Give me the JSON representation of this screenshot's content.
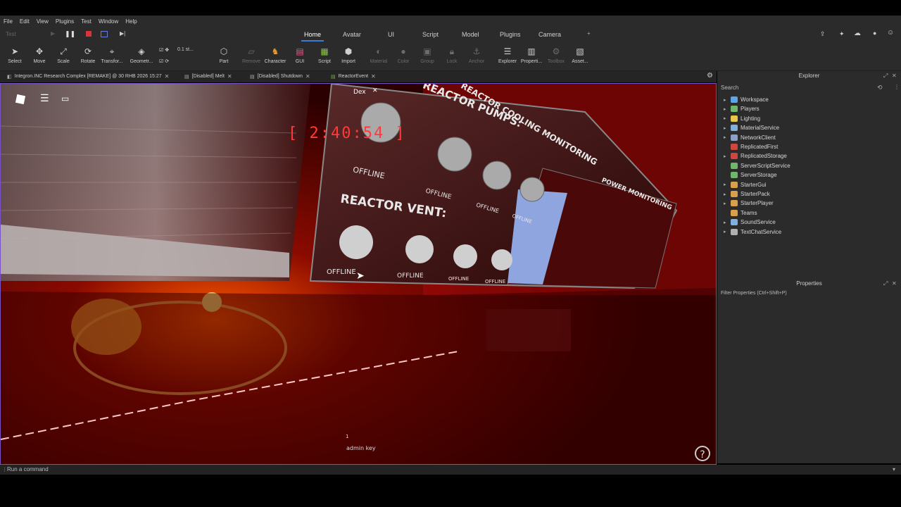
{
  "menu": [
    "File",
    "Edit",
    "View",
    "Plugins",
    "Test",
    "Window",
    "Help"
  ],
  "ribbon_tabs": [
    "Home",
    "Avatar",
    "UI",
    "Script",
    "Model",
    "Plugins",
    "Camera"
  ],
  "active_tab": "Home",
  "test_dropdown": "Test",
  "tools": [
    {
      "label": "Select",
      "icon": "cursor-icon"
    },
    {
      "label": "Move",
      "icon": "move-icon"
    },
    {
      "label": "Scale",
      "icon": "scale-icon"
    },
    {
      "label": "Rotate",
      "icon": "rotate-icon"
    },
    {
      "label": "Transfor...",
      "icon": "transform-icon"
    },
    {
      "label": "Geometr...",
      "icon": "geometry-icon"
    },
    {
      "label": "Part",
      "icon": "part-icon"
    },
    {
      "label": "Remove",
      "icon": "remove-icon"
    },
    {
      "label": "Character",
      "icon": "character-icon"
    },
    {
      "label": "GUI",
      "icon": "gui-icon"
    },
    {
      "label": "Script",
      "icon": "script-icon"
    },
    {
      "label": "Import",
      "icon": "import-icon"
    },
    {
      "label": "Material",
      "icon": "material-icon"
    },
    {
      "label": "Color",
      "icon": "color-icon"
    },
    {
      "label": "Group",
      "icon": "group-icon"
    },
    {
      "label": "Lock",
      "icon": "lock-icon"
    },
    {
      "label": "Anchor",
      "icon": "anchor-icon"
    },
    {
      "label": "Explorer",
      "icon": "explorer-icon"
    },
    {
      "label": "Properti...",
      "icon": "properties-icon"
    },
    {
      "label": "Toolbox",
      "icon": "toolbox-icon"
    },
    {
      "label": "Asset...",
      "icon": "asset-icon"
    }
  ],
  "snap_value": "0.1 st...",
  "doc_tabs": [
    {
      "label": "Integron.INC Research Complex [REMAKE] @ 30 RHB 2026 15:27"
    },
    {
      "label": "[Disabled] Melt"
    },
    {
      "label": "[Disabled] Shutdown"
    },
    {
      "label": "ReactorEvent"
    }
  ],
  "viewport": {
    "dex_label": "Dex",
    "timer": "[ 2:40:54 ]",
    "reactor_pumps": "REACTOR PUMPS:",
    "cooling_monitoring": "REACTOR COOLING MONITORING",
    "reactor_vent": "REACTOR VENT:",
    "power_monitoring": "POWER MONITORING",
    "offline": "OFFLINE",
    "admin_key": "admin key",
    "hotbar_slot": "1"
  },
  "explorer": {
    "title": "Explorer",
    "search_placeholder": "Search",
    "items": [
      {
        "label": "Workspace",
        "expandable": true,
        "color": "#5aa6e8"
      },
      {
        "label": "Players",
        "expandable": true,
        "color": "#6fb86b"
      },
      {
        "label": "Lighting",
        "expandable": true,
        "color": "#e8c64a"
      },
      {
        "label": "MaterialService",
        "expandable": true,
        "color": "#7fb0e0"
      },
      {
        "label": "NetworkClient",
        "expandable": true,
        "color": "#8aa0c8"
      },
      {
        "label": "ReplicatedFirst",
        "expandable": false,
        "color": "#d0453c"
      },
      {
        "label": "ReplicatedStorage",
        "expandable": true,
        "color": "#d0453c"
      },
      {
        "label": "ServerScriptService",
        "expandable": false,
        "color": "#6fb86b"
      },
      {
        "label": "ServerStorage",
        "expandable": false,
        "color": "#6fb86b"
      },
      {
        "label": "StarterGui",
        "expandable": true,
        "color": "#d8a04a"
      },
      {
        "label": "StarterPack",
        "expandable": true,
        "color": "#d8a04a"
      },
      {
        "label": "StarterPlayer",
        "expandable": true,
        "color": "#d8a04a"
      },
      {
        "label": "Teams",
        "expandable": false,
        "color": "#d8a04a"
      },
      {
        "label": "SoundService",
        "expandable": true,
        "color": "#7fb0e0"
      },
      {
        "label": "TextChatService",
        "expandable": true,
        "color": "#b0b0b0"
      }
    ]
  },
  "properties": {
    "title": "Properties",
    "filter_placeholder": "Filter Properties (Ctrl+Shift+P)"
  },
  "command_bar": {
    "placeholder": "Run a command"
  }
}
